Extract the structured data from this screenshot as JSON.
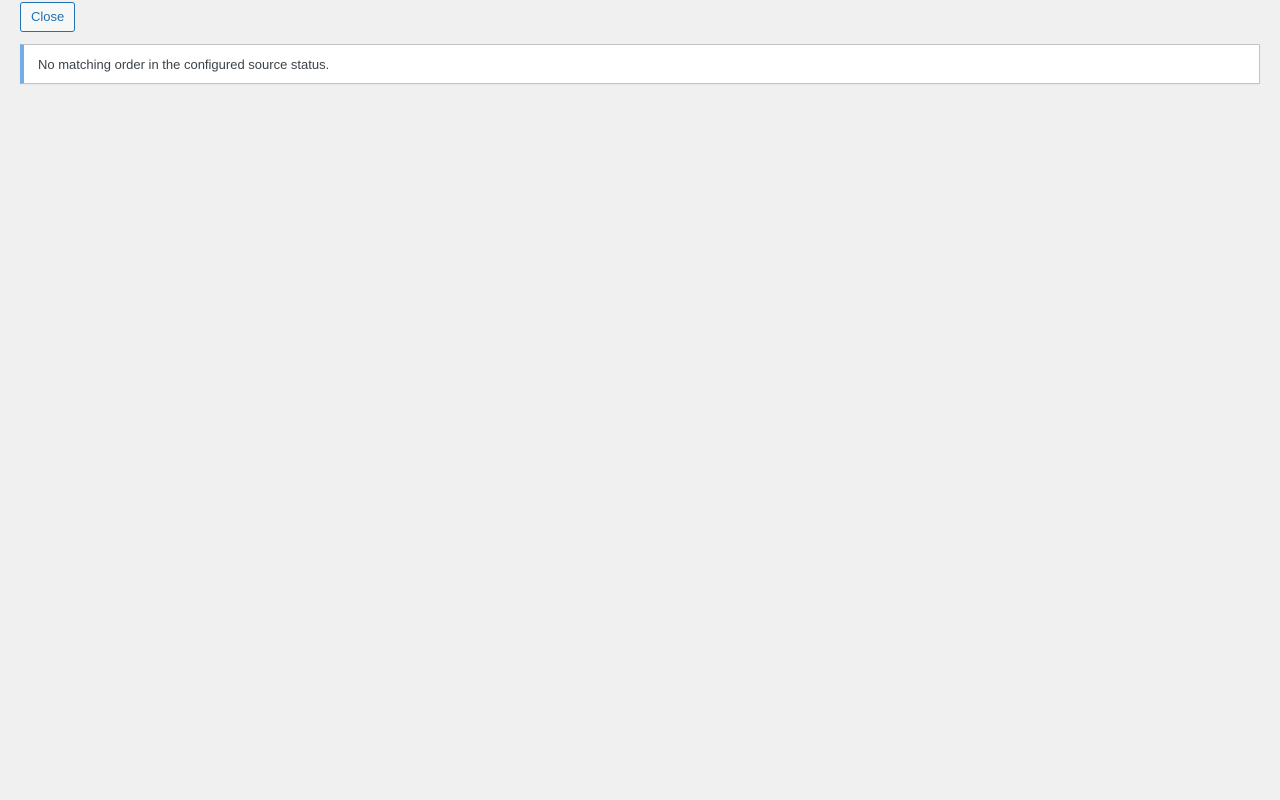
{
  "toolbar": {
    "close_label": "Close"
  },
  "notice": {
    "message": "No matching order in the configured source status.",
    "accent_color": "#72aee6"
  },
  "colors": {
    "background": "#f0f0f1",
    "button_border": "#2271b1",
    "button_text": "#2271b1"
  }
}
